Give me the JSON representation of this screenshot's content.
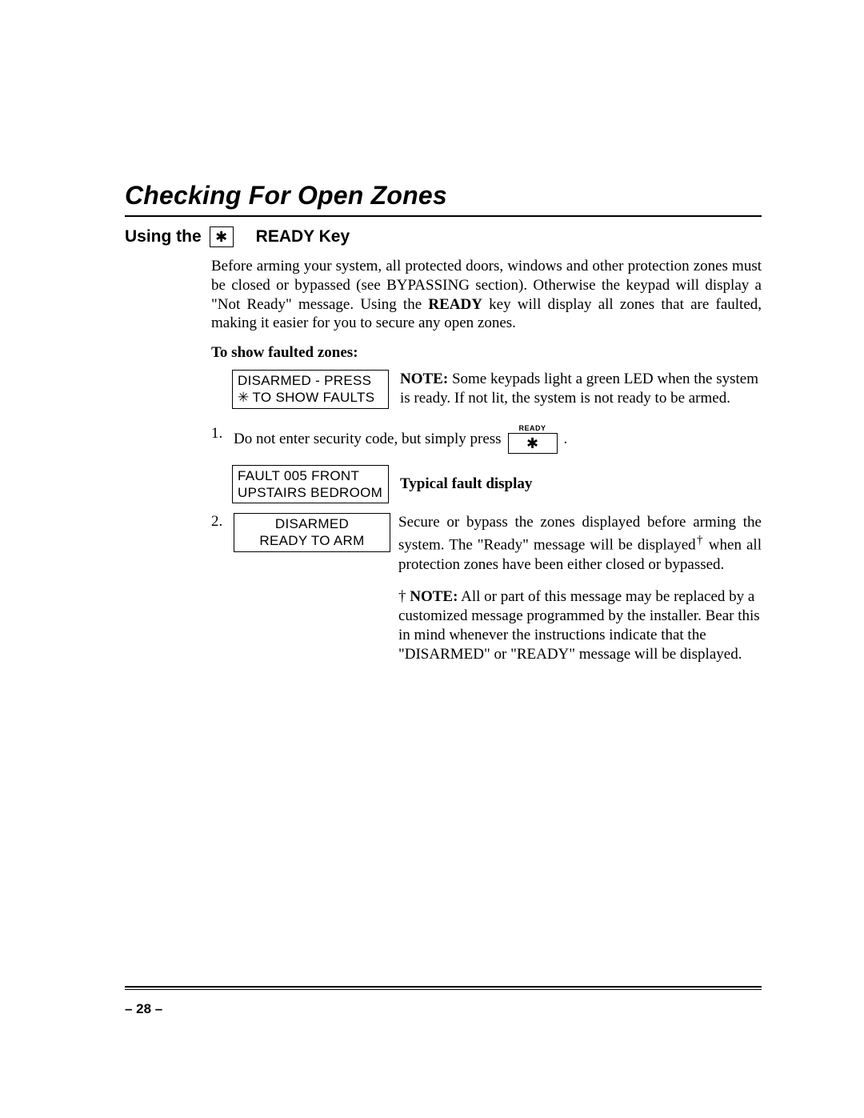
{
  "title": "Checking For Open Zones",
  "subhead": {
    "pre": "Using the",
    "key_glyph": "✱",
    "post": "READY Key"
  },
  "intro": {
    "t1": "Before arming your system, all protected doors, windows and other protection zones must be closed or bypassed (see BYPASSING section).  Otherwise the keypad will display a \"Not Ready\" message. Using the ",
    "bold": "READY",
    "t2": " key will display all zones that are faulted, making it easier for you to secure any open zones."
  },
  "sub2": "To show faulted zones:",
  "lcd1": {
    "line1": "DISARMED - PRESS",
    "line2_glyph": "✳",
    "line2_text": " TO SHOW FAULTS"
  },
  "note1": {
    "label": "NOTE:",
    "text": " Some keypads light a green LED when the system is ready. If not lit, the system is not ready to be armed."
  },
  "step1": {
    "num": "1.",
    "text": "Do not enter security code, but simply press",
    "key_label": "READY",
    "key_glyph": "✱",
    "period": "."
  },
  "lcd2": {
    "line1": "FAULT   005  FRONT",
    "line2": "UPSTAIRS BEDROOM"
  },
  "typical": "Typical fault display",
  "step2": {
    "num": "2.",
    "lcd_line1": "DISARMED",
    "lcd_line2": "READY TO ARM",
    "para_a": "Secure or bypass the zones displayed before arming the system. The \"Ready\" message will be displayed",
    "dagger": "†",
    "para_b": " when all protection zones have been either closed or bypassed."
  },
  "footnote": {
    "dagger": "†",
    "label": " NOTE:",
    "text": " All or part of this message may be replaced by a customized message programmed by the installer.  Bear this in mind whenever the instructions indicate that the \"DISARMED\" or \"READY\" message will be displayed."
  },
  "page_num": "– 28 –"
}
